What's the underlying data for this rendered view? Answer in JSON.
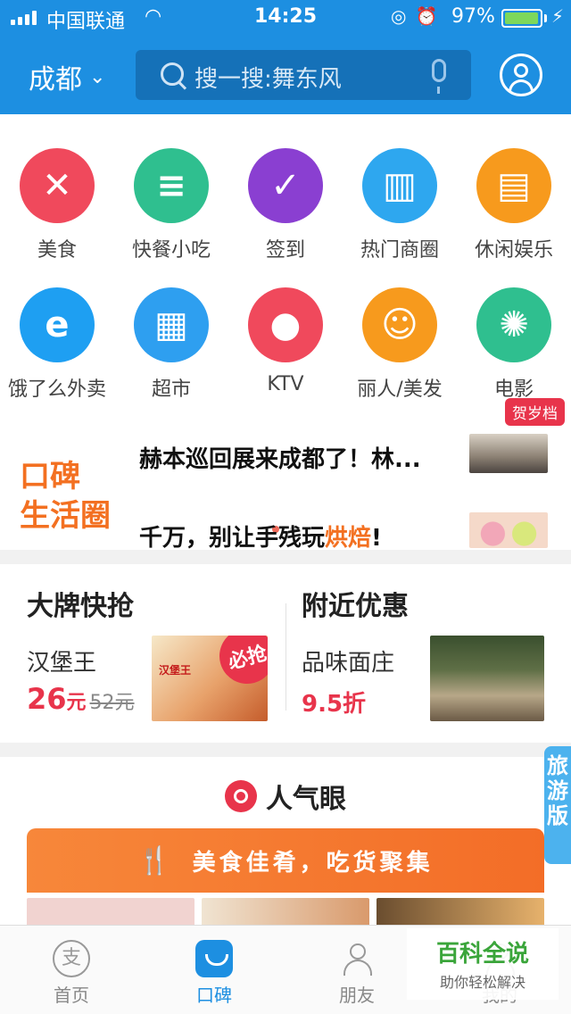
{
  "status": {
    "carrier": "中国联通",
    "time": "14:25",
    "battery": "97%"
  },
  "header": {
    "city": "成都",
    "search_placeholder": "搜一搜:舞东风"
  },
  "categories": [
    {
      "label": "美食",
      "color": "#f0495c",
      "icon": "fork-knife-icon",
      "glyph": "✕"
    },
    {
      "label": "快餐小吃",
      "color": "#2fbf8f",
      "icon": "burger-icon",
      "glyph": "≡"
    },
    {
      "label": "签到",
      "color": "#8a3fd1",
      "icon": "check-icon",
      "glyph": "✓"
    },
    {
      "label": "热门商圈",
      "color": "#2ea7ef",
      "icon": "buildings-icon",
      "glyph": "▥"
    },
    {
      "label": "休闲娱乐",
      "color": "#f79a1d",
      "icon": "gameboy-icon",
      "glyph": "▤"
    },
    {
      "label": "饿了么外卖",
      "color": "#1e9ff2",
      "icon": "eleme-icon",
      "glyph": "e"
    },
    {
      "label": "超市",
      "color": "#2e9ff0",
      "icon": "basket-icon",
      "glyph": "▦"
    },
    {
      "label": "KTV",
      "color": "#f0495c",
      "icon": "microphone-icon",
      "glyph": "●"
    },
    {
      "label": "丽人/美发",
      "color": "#f79a1d",
      "icon": "woman-icon",
      "glyph": "☺"
    },
    {
      "label": "电影",
      "color": "#2fbf8f",
      "icon": "film-reel-icon",
      "glyph": "✺"
    }
  ],
  "badge": "贺岁档",
  "koubei": {
    "logo_line1": "口碑",
    "logo_line2": "生活圈",
    "news1": "赫本巡回展来成都了！林...",
    "news2_pre": "千万，别让手残玩",
    "news2_hl": "烘焙",
    "news2_post": "!"
  },
  "deals": {
    "left_title": "大牌快抢",
    "left_name": "汉堡王",
    "left_price": "26",
    "left_unit": "元",
    "left_old": "52元",
    "left_stamp": "必抢",
    "left_brand": "汉堡王",
    "right_title": "附近优惠",
    "right_name": "品味面庄",
    "right_discount": "9.5折"
  },
  "popular": {
    "title": "人气眼",
    "banner": "美食佳肴，吃货聚集"
  },
  "travel": "旅游版",
  "tabs": [
    {
      "label": "首页"
    },
    {
      "label": "口碑"
    },
    {
      "label": "朋友"
    },
    {
      "label": "我的"
    }
  ],
  "watermark": {
    "line1": "百科全说",
    "line2": "助你轻松解决"
  }
}
